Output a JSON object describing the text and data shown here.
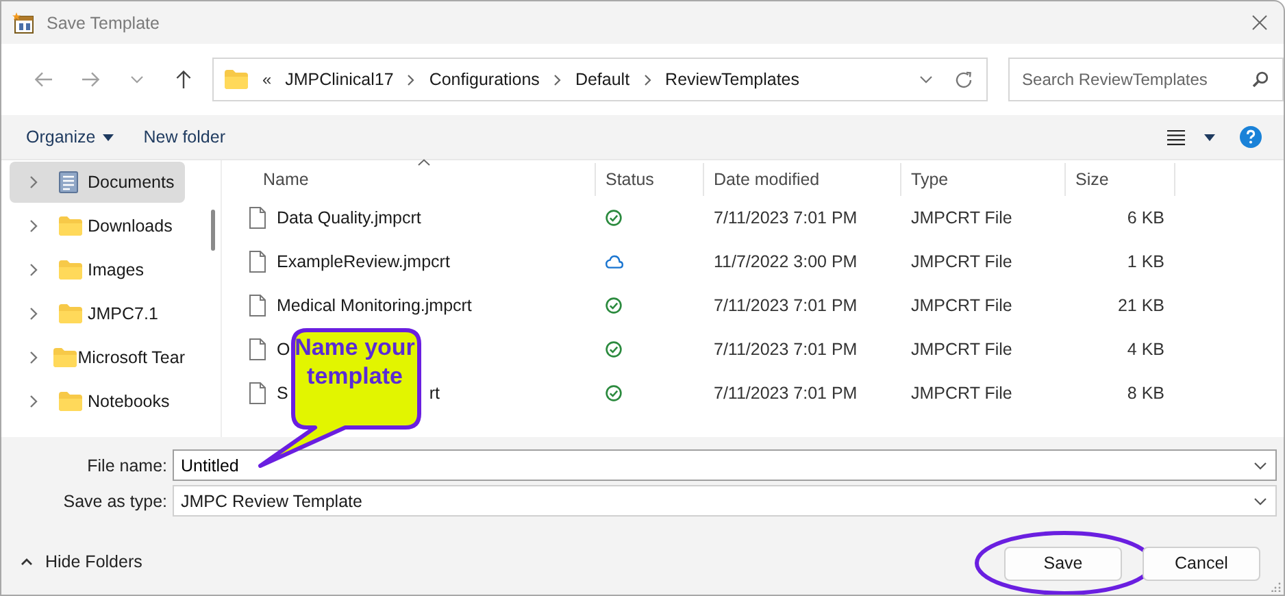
{
  "window": {
    "title": "Save Template"
  },
  "address": {
    "overflow": "«",
    "segments": [
      "JMPClinical17",
      "Configurations",
      "Default",
      "ReviewTemplates"
    ]
  },
  "search": {
    "placeholder": "Search ReviewTemplates"
  },
  "toolbar": {
    "organize": "Organize",
    "new_folder": "New folder"
  },
  "sidebar": {
    "items": [
      {
        "label": "Documents",
        "kind": "document",
        "selected": true
      },
      {
        "label": "Downloads",
        "kind": "folder",
        "selected": false
      },
      {
        "label": "Images",
        "kind": "folder",
        "selected": false
      },
      {
        "label": "JMPC7.1",
        "kind": "folder",
        "selected": false
      },
      {
        "label": "Microsoft Tear",
        "kind": "folder",
        "selected": false
      },
      {
        "label": "Notebooks",
        "kind": "folder",
        "selected": false
      }
    ]
  },
  "table": {
    "columns": [
      "Name",
      "Status",
      "Date modified",
      "Type",
      "Size"
    ],
    "rows": [
      {
        "name": [
          "Data Quality.jmpcrt"
        ],
        "kind": "synced",
        "date": "7/11/2023 7:01 PM",
        "type": "JMPCRT File",
        "size": "6 KB"
      },
      {
        "name": [
          "ExampleReview.jmpcrt"
        ],
        "kind": "cloud",
        "date": "11/7/2022 3:00 PM",
        "type": "JMPCRT File",
        "size": "1 KB"
      },
      {
        "name": [
          "Medical Monitoring.jmpcrt"
        ],
        "kind": "synced",
        "date": "7/11/2023 7:01 PM",
        "type": "JMPCRT File",
        "size": "21 KB"
      },
      {
        "name": [
          "O"
        ],
        "kind": "synced",
        "date": "7/11/2023 7:01 PM",
        "type": "JMPCRT File",
        "size": "4 KB"
      },
      {
        "name": [
          "S",
          "rt"
        ],
        "kind": "synced",
        "date": "7/11/2023 7:01 PM",
        "type": "JMPCRT File",
        "size": "8 KB"
      }
    ]
  },
  "file_name": {
    "label": "File name:",
    "value": "Untitled"
  },
  "save_type": {
    "label": "Save as type:",
    "value": "JMPC Review Template"
  },
  "hide_folders": "Hide Folders",
  "buttons": [
    {
      "label": "Save",
      "highlighted": true
    },
    {
      "label": "Cancel",
      "highlighted": false
    }
  ],
  "callout": {
    "text": "Name your template"
  }
}
